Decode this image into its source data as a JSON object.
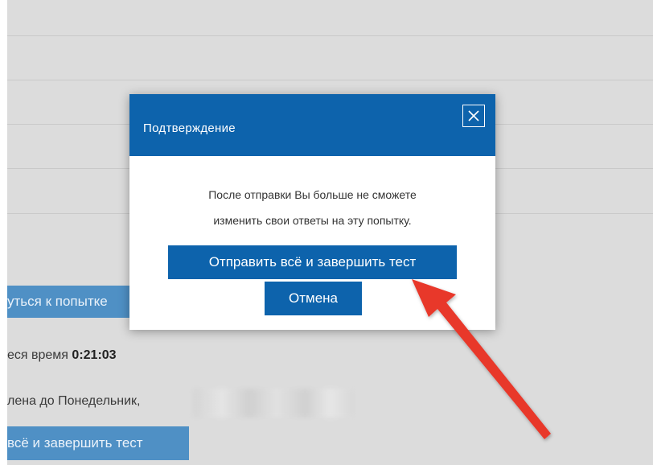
{
  "background": {
    "return_button_label": "уться к попытке",
    "remaining_time_label": "еся время ",
    "remaining_time_value": "0:21:03",
    "deadline_text": "лена до Понедельник,",
    "submit_button_label": "всё и завершить тест"
  },
  "dialog": {
    "title": "Подтверждение",
    "message_line1": "После отправки Вы больше не сможете",
    "message_line2": "изменить свои ответы на эту попытку.",
    "submit_label": "Отправить всё и завершить тест",
    "cancel_label": "Отмена",
    "close_icon": "close-icon"
  },
  "annotation": {
    "arrow_color": "#e8372c",
    "arrow_icon": "red-arrow-pointer"
  },
  "colors": {
    "accent": "#0d63ac",
    "background_button": "#4f90c5",
    "page_overlay": "#dcdcdc"
  }
}
